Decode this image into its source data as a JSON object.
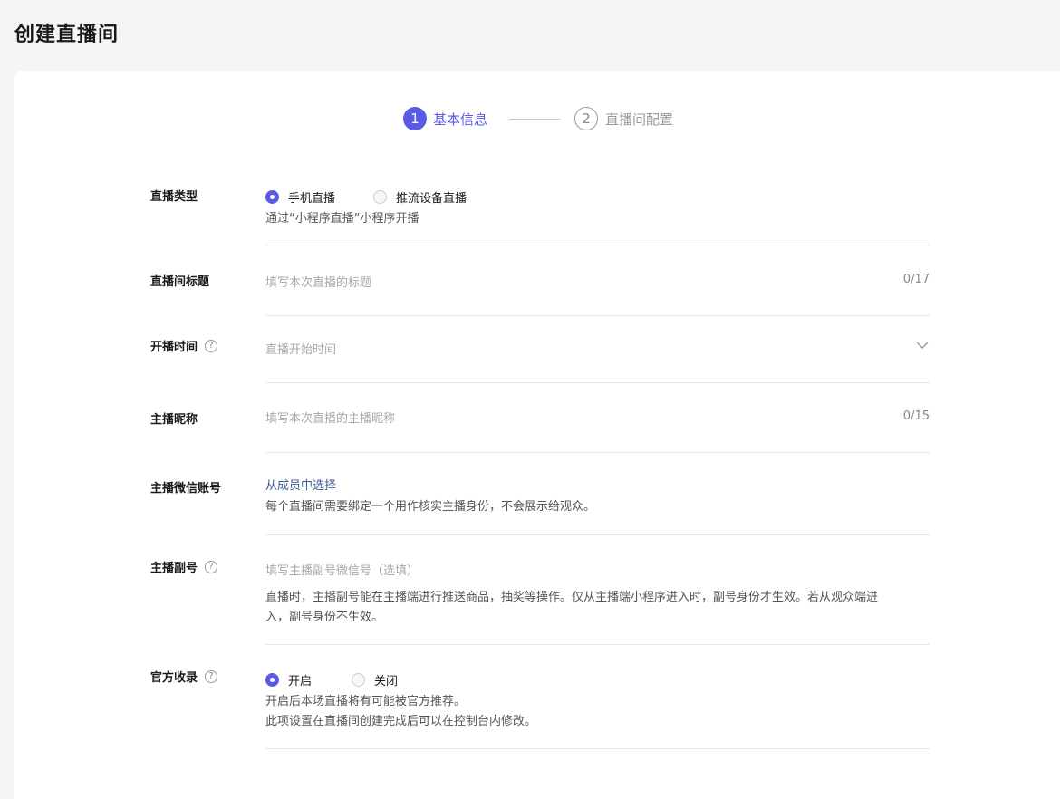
{
  "page": {
    "title": "创建直播间"
  },
  "steps": [
    {
      "num": "1",
      "label": "基本信息"
    },
    {
      "num": "2",
      "label": "直播间配置"
    }
  ],
  "live_type": {
    "label": "直播类型",
    "options": [
      "手机直播",
      "推流设备直播"
    ],
    "selected": "手机直播",
    "hint": "通过“小程序直播”小程序开播"
  },
  "room_title": {
    "label": "直播间标题",
    "placeholder": "填写本次直播的标题",
    "counter": "0/17"
  },
  "start_time": {
    "label": "开播时间",
    "placeholder": "直播开始时间"
  },
  "anchor_nickname": {
    "label": "主播昵称",
    "placeholder": "填写本次直播的主播昵称",
    "counter": "0/15"
  },
  "anchor_wechat": {
    "label": "主播微信账号",
    "link": "从成员中选择",
    "hint": "每个直播间需要绑定一个用作核实主播身份，不会展示给观众。"
  },
  "anchor_sub": {
    "label": "主播副号",
    "placeholder": "填写主播副号微信号（选填）",
    "hint_line1": "直播时，主播副号能在主播端进行推送商品，抽奖等操作。仅从主播端小程序进入时，副号身份才生效。若从观众端进",
    "hint_line2": "入，副号身份不生效。"
  },
  "official": {
    "label": "官方收录",
    "options": [
      "开启",
      "关闭"
    ],
    "selected": "开启",
    "hint_line1": "开启后本场直播将有可能被官方推荐。",
    "hint_line2": "此项设置在直播间创建完成后可以在控制台内修改。"
  },
  "colors": {
    "accent": "#5a5be5",
    "link": "#3d5a96"
  },
  "icons": {
    "help": "help-circle-icon",
    "dropdown": "chevron-down-icon"
  }
}
